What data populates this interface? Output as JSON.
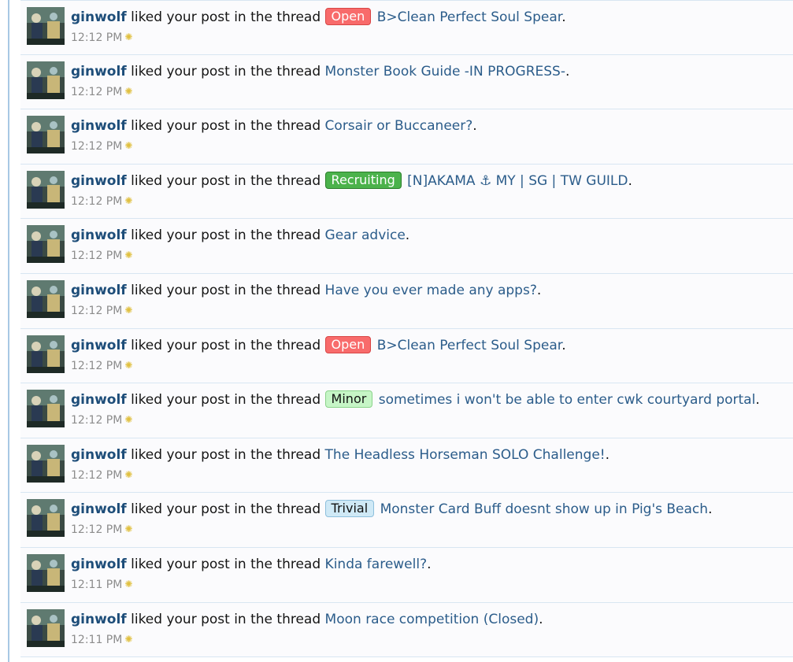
{
  "alerts": [
    {
      "user": "ginwolf",
      "action": "liked your post in the thread",
      "prefix": "Open",
      "prefix_style": "red",
      "thread": "B>Clean Perfect Soul Spear",
      "time": "12:12 PM"
    },
    {
      "user": "ginwolf",
      "action": "liked your post in the thread",
      "prefix": null,
      "prefix_style": null,
      "thread": "Monster Book Guide -IN PROGRESS-",
      "time": "12:12 PM"
    },
    {
      "user": "ginwolf",
      "action": "liked your post in the thread",
      "prefix": null,
      "prefix_style": null,
      "thread": "Corsair or Buccaneer?",
      "time": "12:12 PM"
    },
    {
      "user": "ginwolf",
      "action": "liked your post in the thread",
      "prefix": "Recruiting",
      "prefix_style": "green",
      "thread": "[N]AKAMA ⚓ MY | SG | TW GUILD",
      "time": "12:12 PM"
    },
    {
      "user": "ginwolf",
      "action": "liked your post in the thread",
      "prefix": null,
      "prefix_style": null,
      "thread": "Gear advice",
      "time": "12:12 PM"
    },
    {
      "user": "ginwolf",
      "action": "liked your post in the thread",
      "prefix": null,
      "prefix_style": null,
      "thread": "Have you ever made any apps?",
      "time": "12:12 PM"
    },
    {
      "user": "ginwolf",
      "action": "liked your post in the thread",
      "prefix": "Open",
      "prefix_style": "red",
      "thread": "B>Clean Perfect Soul Spear",
      "time": "12:12 PM"
    },
    {
      "user": "ginwolf",
      "action": "liked your post in the thread",
      "prefix": "Minor",
      "prefix_style": "lightgreen",
      "thread": "sometimes i won't be able to enter cwk courtyard portal",
      "time": "12:12 PM"
    },
    {
      "user": "ginwolf",
      "action": "liked your post in the thread",
      "prefix": null,
      "prefix_style": null,
      "thread": "The Headless Horseman SOLO Challenge!",
      "time": "12:12 PM"
    },
    {
      "user": "ginwolf",
      "action": "liked your post in the thread",
      "prefix": "Trivial",
      "prefix_style": "lightblue",
      "thread": "Monster Card Buff doesnt show up in Pig's Beach",
      "time": "12:12 PM"
    },
    {
      "user": "ginwolf",
      "action": "liked your post in the thread",
      "prefix": null,
      "prefix_style": null,
      "thread": "Kinda farewell?",
      "time": "12:11 PM"
    },
    {
      "user": "ginwolf",
      "action": "liked your post in the thread",
      "prefix": null,
      "prefix_style": null,
      "thread": "Moon race competition (Closed)",
      "time": "12:11 PM"
    }
  ],
  "period": ".",
  "new_marker_icon": "sparkle-icon",
  "colors": {
    "user": "#1d4d79",
    "link": "#2b5c8a",
    "time": "#8c8c8c",
    "divider": "#d8e6f2"
  }
}
